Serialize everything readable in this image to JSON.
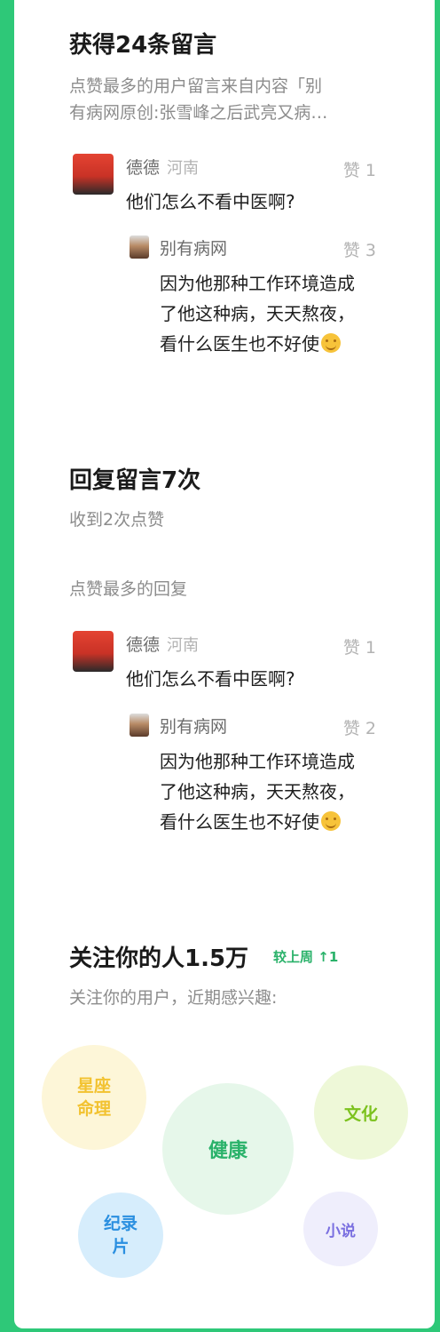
{
  "comments_section": {
    "title": "获得24条留言",
    "description_line1": "点赞最多的用户留言来自内容「别",
    "description_line2": "有病网原创:张雪峰之后武亮又病…",
    "comment": {
      "user": "德德",
      "location": "河南",
      "likes": "赞 1",
      "text": "他们怎么不看中医啊?"
    },
    "reply": {
      "user": "别有病网",
      "likes": "赞 3",
      "line1": "因为他那种工作环境造成",
      "line2": "了他这种病，天天熬夜，",
      "line3": "看什么医生也不好使"
    }
  },
  "replies_section": {
    "title": "回复留言7次",
    "likes_received": "收到2次点赞",
    "top_reply_label": "点赞最多的回复",
    "comment": {
      "user": "德德",
      "location": "河南",
      "likes": "赞 1",
      "text": "他们怎么不看中医啊?"
    },
    "reply": {
      "user": "别有病网",
      "likes": "赞 2",
      "line1": "因为他那种工作环境造成",
      "line2": "了他这种病，天天熬夜，",
      "line3": "看什么医生也不好使"
    }
  },
  "followers_section": {
    "title": "关注你的人1.5万",
    "change": "较上周",
    "change_value": "↑1",
    "subtitle": "关注你的用户，近期感兴趣:",
    "interests": [
      {
        "label": "星座\n命理",
        "color": "#f2c230",
        "bg": "#fdf6d8"
      },
      {
        "label": "健康",
        "color": "#2ab26a",
        "bg": "#e6f7ea"
      },
      {
        "label": "文化",
        "color": "#7cc21e",
        "bg": "#eef8d8"
      },
      {
        "label": "纪录\n片",
        "color": "#2a8fe0",
        "bg": "#d6edfc"
      },
      {
        "label": "小说",
        "color": "#7a6fe0",
        "bg": "#efeefc"
      }
    ]
  },
  "colors": {
    "frame_green": "#2ec878",
    "accent_green": "#2ab26a"
  }
}
